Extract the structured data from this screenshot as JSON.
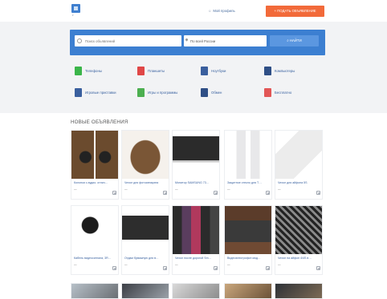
{
  "header": {
    "profile_link": "Мой профиль",
    "post_button": "+ ПОДАТЬ ОБЪЯВЛЕНИЕ"
  },
  "search": {
    "query_placeholder": "Поиск объявлений",
    "region_value": "По всей России",
    "find_button": "НАЙТИ"
  },
  "categories": [
    {
      "label": "Телефоны",
      "color": "#3bb54a"
    },
    {
      "label": "Планшеты",
      "color": "#e04747"
    },
    {
      "label": "Ноутбуки",
      "color": "#3a5f9e"
    },
    {
      "label": "Компьютеры",
      "color": "#2f4f86"
    },
    {
      "label": "Игровые приставки",
      "color": "#3a5f9e"
    },
    {
      "label": "Игры и программы",
      "color": "#4caf50"
    },
    {
      "label": "Обмен",
      "color": "#2f4f86"
    },
    {
      "label": "Бесплатно",
      "color": "#e25656"
    }
  ],
  "listings_title": "НОВЫЕ ОБЪЯВЛЕНИЯ",
  "listings": [
    {
      "title": "Колонки с аудио. отлич…",
      "price": "—",
      "image": "speakers"
    },
    {
      "title": "Чехол для фотоаппарата",
      "price": "—",
      "image": "leather-case"
    },
    {
      "title": "Монитор SAMSUNG 73…",
      "price": "—",
      "image": "monitor"
    },
    {
      "title": "Защитное стекло для T…",
      "price": "—",
      "image": "phone-glass"
    },
    {
      "title": "Чехол для айфона 5S",
      "price": "—",
      "image": "white-case"
    },
    {
      "title": "Кабель видеосигнала, 3R…",
      "price": "—",
      "image": "av-cable"
    },
    {
      "title": "Отдам бумажную для в…",
      "price": "—",
      "image": "printer-cartridge"
    },
    {
      "title": "Чехол после дорогой Sm…",
      "price": "—",
      "image": "phone-cases"
    },
    {
      "title": "Видеоэлектрофон мод…",
      "price": "—",
      "image": "dvd-player"
    },
    {
      "title": "Чехол на айфон 4/4S в…",
      "price": "—",
      "image": "patterned-case"
    }
  ]
}
